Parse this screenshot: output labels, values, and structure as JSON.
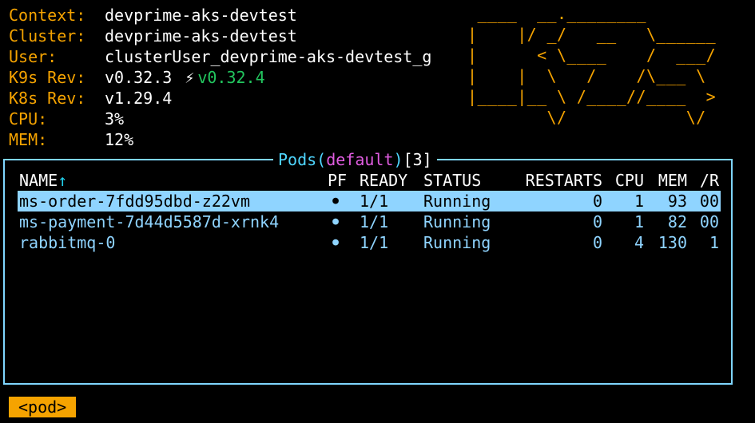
{
  "info": [
    {
      "label": "Context:",
      "value": "devprime-aks-devtest"
    },
    {
      "label": "Cluster:",
      "value": "devprime-aks-devtest"
    },
    {
      "label": "User:",
      "value": "clusterUser_devprime-aks-devtest_g"
    },
    {
      "label": "K9s Rev:",
      "value": "v0.32.3",
      "latest": "v0.32.4",
      "icon": "bolt-icon"
    },
    {
      "label": "K8s Rev:",
      "value": "v1.29.4"
    },
    {
      "label": "CPU:",
      "value": "3%"
    },
    {
      "label": "MEM:",
      "value": "12%"
    }
  ],
  "logo_ascii": " ____  __.________\n|    |/ _/   __   \\______\n|      < \\____    /  ___/\n|    |  \\   /    /\\___ \\\n|____|__ \\ /____//____  >\n        \\/            \\/",
  "panel": {
    "title_prefix": "Pods(",
    "namespace": "default",
    "title_suffix": ")",
    "count": "[3]"
  },
  "table": {
    "headers": {
      "name": "NAME",
      "name_sort": "↑",
      "pf": "PF",
      "ready": "READY",
      "status": "STATUS",
      "restarts": "RESTARTS",
      "cpu": "CPU",
      "mem": "MEM",
      "r": "/R"
    },
    "rows": [
      {
        "name": "ms-order-7fdd95dbd-z22vm",
        "pf": "●",
        "ready": "1/1",
        "status": "Running",
        "restarts": "0",
        "cpu": "1",
        "mem": "93",
        "r": "00"
      },
      {
        "name": "ms-payment-7d44d5587d-xrnk4",
        "pf": "●",
        "ready": "1/1",
        "status": "Running",
        "restarts": "0",
        "cpu": "1",
        "mem": "82",
        "r": "00"
      },
      {
        "name": "rabbitmq-0",
        "pf": "●",
        "ready": "1/1",
        "status": "Running",
        "restarts": "0",
        "cpu": "4",
        "mem": "130",
        "r": "1"
      }
    ]
  },
  "crumb": "<pod>",
  "colors": {
    "accent_orange": "#f5a300",
    "panel_cyan": "#7fd6ff",
    "namespace_magenta": "#e05ce0",
    "latest_green": "#22c55e",
    "row_blue": "#8fd4ff"
  }
}
